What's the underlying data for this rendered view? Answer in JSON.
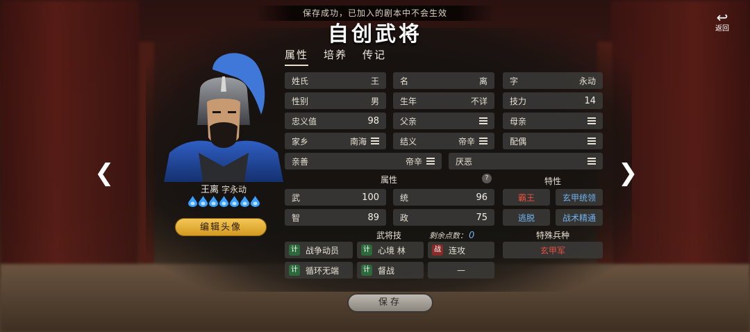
{
  "banner": "保存成功，已加入的剧本中不会生效",
  "title": "自创武将",
  "back": {
    "icon": "return-icon",
    "label": "返回"
  },
  "hero": {
    "name": "王离",
    "courtesy": "字永动",
    "drop_count": 7,
    "drop_color": "#3aa0ff",
    "edit_label": "编辑头像"
  },
  "tabs": [
    {
      "label": "属性",
      "active": true
    },
    {
      "label": "培养",
      "active": false
    },
    {
      "label": "传记",
      "active": false
    }
  ],
  "fields": {
    "surname": {
      "label": "姓氏",
      "value": "王"
    },
    "given": {
      "label": "名",
      "value": "离"
    },
    "style": {
      "label": "字",
      "value": "永动"
    },
    "gender": {
      "label": "性别",
      "value": "男"
    },
    "birth": {
      "label": "生年",
      "value": "不详"
    },
    "skill_pts": {
      "label": "技力",
      "value": "14"
    },
    "loyalty": {
      "label": "忠义值",
      "value": "98"
    },
    "father": {
      "label": "父亲"
    },
    "mother": {
      "label": "母亲"
    },
    "hometown": {
      "label": "家乡",
      "value": "南海"
    },
    "sworn": {
      "label": "结义",
      "value": "帝辛"
    },
    "spouse": {
      "label": "配偶"
    },
    "likes": {
      "label": "亲善",
      "value": "帝辛"
    },
    "dislikes": {
      "label": "厌恶"
    }
  },
  "stats_title": "属性",
  "stats": {
    "war": {
      "label": "武",
      "value": "100"
    },
    "lead": {
      "label": "统",
      "value": "96"
    },
    "int": {
      "label": "智",
      "value": "89"
    },
    "pol": {
      "label": "政",
      "value": "75"
    }
  },
  "traits_title": "特性",
  "traits": [
    {
      "label": "霸王",
      "color": "red"
    },
    {
      "label": "玄甲统领",
      "color": "blue"
    },
    {
      "label": "逃脱",
      "color": "blue"
    },
    {
      "label": "战术精通",
      "color": "blue"
    }
  ],
  "skills_title": "武将技",
  "remaining": {
    "label": "剩余点数：",
    "value": "0"
  },
  "skills": [
    {
      "badge": "计",
      "type": "green",
      "label": "战争动员"
    },
    {
      "badge": "计",
      "type": "green",
      "label": "心境 林"
    },
    {
      "badge": "战",
      "type": "red",
      "label": "连攻"
    },
    {
      "badge": "计",
      "type": "green",
      "label": "循环无端"
    },
    {
      "badge": "计",
      "type": "green",
      "label": "督战"
    },
    {
      "badge": "",
      "type": "empty",
      "label": "—"
    }
  ],
  "troops_title": "特殊兵种",
  "troop": "玄甲军",
  "save_label": "保存"
}
